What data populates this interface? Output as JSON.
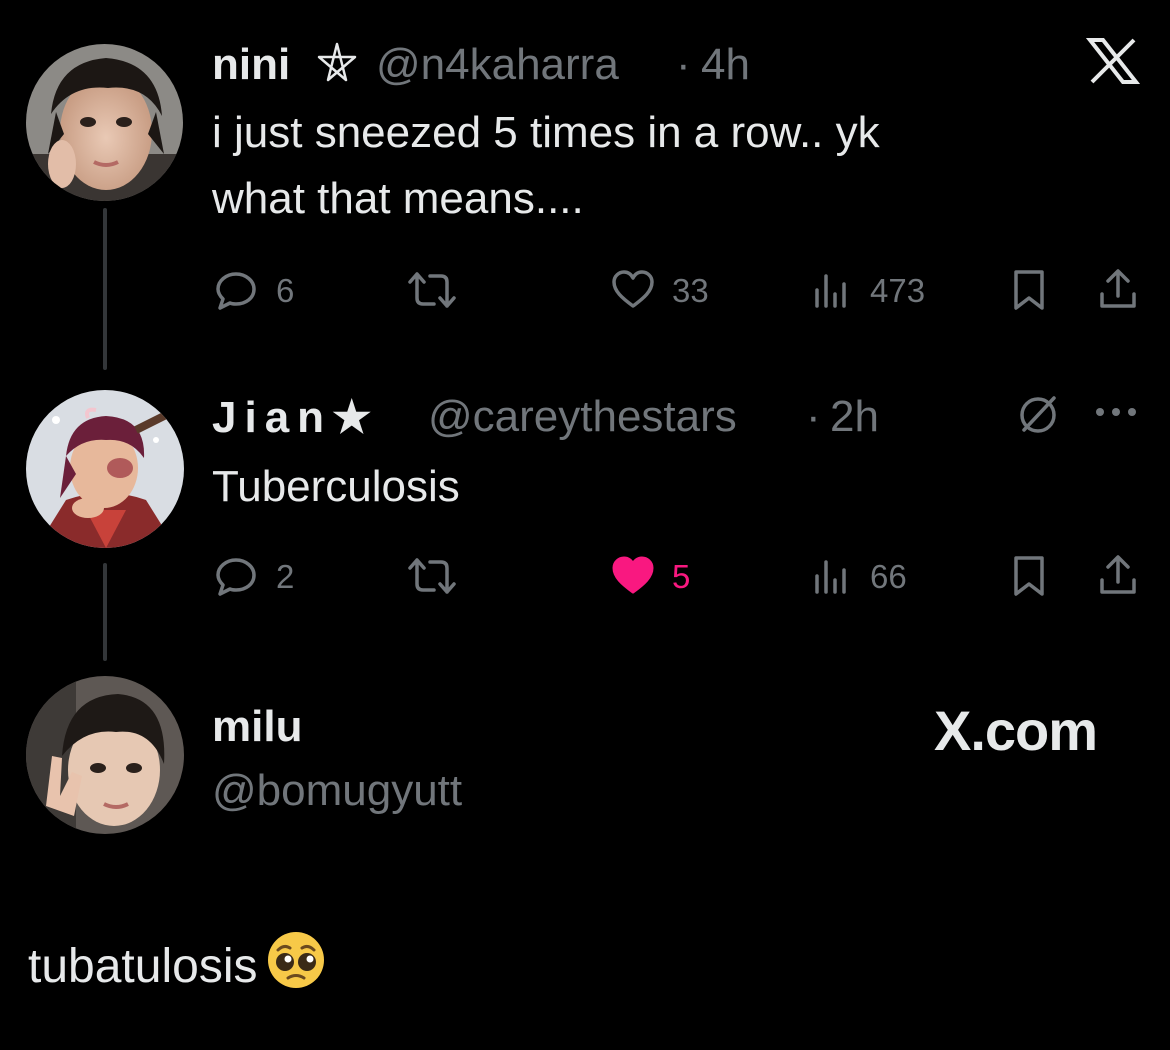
{
  "tweets": [
    {
      "name": "nini",
      "handle": "@n4kaharra",
      "time": "4h",
      "text_line1": "i just sneezed 5 times in a row.. yk",
      "text_line2": "what that means....",
      "replies": "6",
      "likes": "33",
      "views": "473",
      "liked": false
    },
    {
      "name": "Jian★",
      "handle": "@careythestars",
      "time": "2h",
      "text_line1": "Tuberculosis",
      "replies": "2",
      "likes": "5",
      "views": "66",
      "liked": true
    }
  ],
  "quote_author": {
    "name": "milu",
    "handle": "@bomugyutt",
    "watermark": "X.com"
  },
  "quote_text": "tubatulosis",
  "quote_emoji": "🥺",
  "separator": "·",
  "colors": {
    "background": "#000000",
    "text": "#e7e9ea",
    "muted": "#71767b",
    "like_active": "#f91880",
    "thread_line": "#333639"
  },
  "icons": [
    "x-logo-icon",
    "pentagram-icon",
    "reply-icon",
    "retweet-icon",
    "heart-icon",
    "views-icon",
    "bookmark-icon",
    "share-icon",
    "no-entry-icon",
    "more-icon",
    "pleading-face-emoji"
  ]
}
